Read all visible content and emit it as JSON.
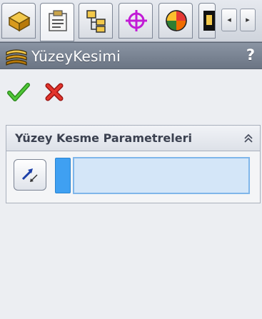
{
  "tabs": [
    {
      "name": "feature-manager",
      "icon": "feature-tree-icon",
      "active": false
    },
    {
      "name": "property-manager",
      "icon": "property-manager-icon",
      "active": true
    },
    {
      "name": "configuration-manager",
      "icon": "configuration-manager-icon",
      "active": false
    },
    {
      "name": "dimxpert-manager",
      "icon": "target-crosshair-icon",
      "active": false
    },
    {
      "name": "display-manager",
      "icon": "appearance-sphere-icon",
      "active": false
    },
    {
      "name": "cam-manager",
      "icon": "cam-icon",
      "active": false
    }
  ],
  "tab_scroll": {
    "left": "◂",
    "right": "▸"
  },
  "panel": {
    "title": "YüzeyKesimi",
    "help": "?"
  },
  "group": {
    "title": "Yüzey Kesme Parametreleri",
    "collapse_glyph": "collapse-chevrons-icon"
  },
  "colors": {
    "accept": "#3fae29",
    "cancel": "#d8221e",
    "selection_box": "#d4e6f8",
    "selection_marker": "#3fa0f2"
  }
}
